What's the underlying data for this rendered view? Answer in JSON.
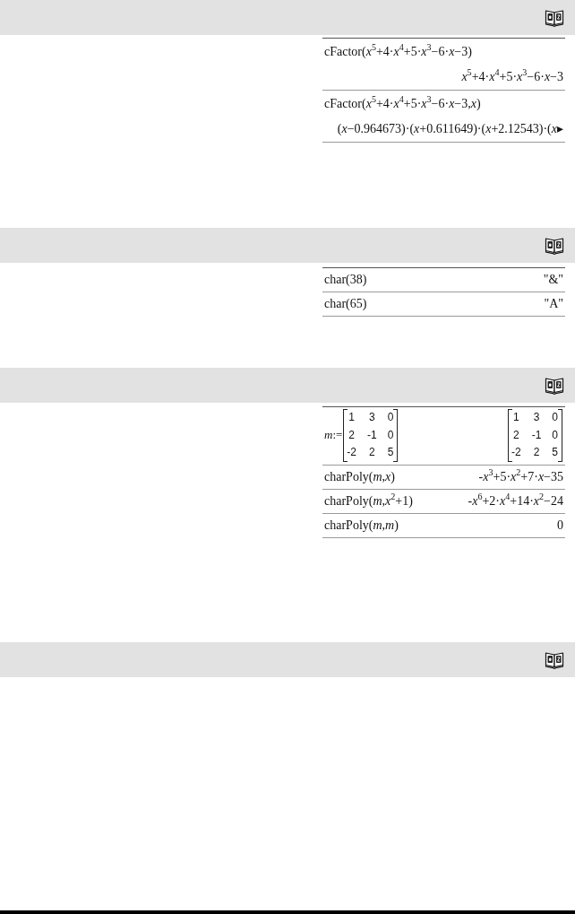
{
  "sections": [
    {
      "catalog_icon": true,
      "examples": [
        {
          "kind": "expression",
          "input": "cFactor(*x*$^{5}$+4·*x*$^{4}$+5·*x*$^{3}$−6·*x*−3)",
          "output": "*x*$^{5}$+4·*x*$^{4}$+5·*x*$^{3}$−6·*x*−3"
        },
        {
          "kind": "expression",
          "input": "cFactor(*x*$^{5}$+4·*x*$^{4}$+5·*x*$^{3}$−6·*x*−3,*x*)",
          "output": "(*x*−0.964673)·(*x*+0.611649)·(*x*+2.12543)·(*x*▸"
        }
      ]
    },
    {
      "catalog_icon": true,
      "examples": [
        {
          "kind": "expression",
          "input": "char(38)",
          "output": "\"&\""
        },
        {
          "kind": "expression",
          "input": "char(65)",
          "output": "\"A\""
        }
      ]
    },
    {
      "catalog_icon": true,
      "examples": [
        {
          "kind": "matrix",
          "input_prefix": "*m*:=",
          "input_matrix": [
            [
              "1",
              "3",
              "0"
            ],
            [
              "2",
              "-1",
              "0"
            ],
            [
              "-2",
              "2",
              "5"
            ]
          ],
          "output_matrix": [
            [
              "1",
              "3",
              "0"
            ],
            [
              "2",
              "-1",
              "0"
            ],
            [
              "-2",
              "2",
              "5"
            ]
          ]
        },
        {
          "kind": "expression",
          "input": "charPoly(*m*,*x*)",
          "output": "-*x*$^{3}$+5·*x*$^{2}$+7·*x*−35"
        },
        {
          "kind": "expression",
          "input": "charPoly(*m*,*x*$^{2}$+1)",
          "output": "-*x*$^{6}$+2·*x*$^{4}$+14·*x*$^{2}$−24"
        },
        {
          "kind": "expression",
          "input": "charPoly(*m*,*m*)",
          "output": "0"
        }
      ]
    },
    {
      "catalog_icon": true
    }
  ]
}
